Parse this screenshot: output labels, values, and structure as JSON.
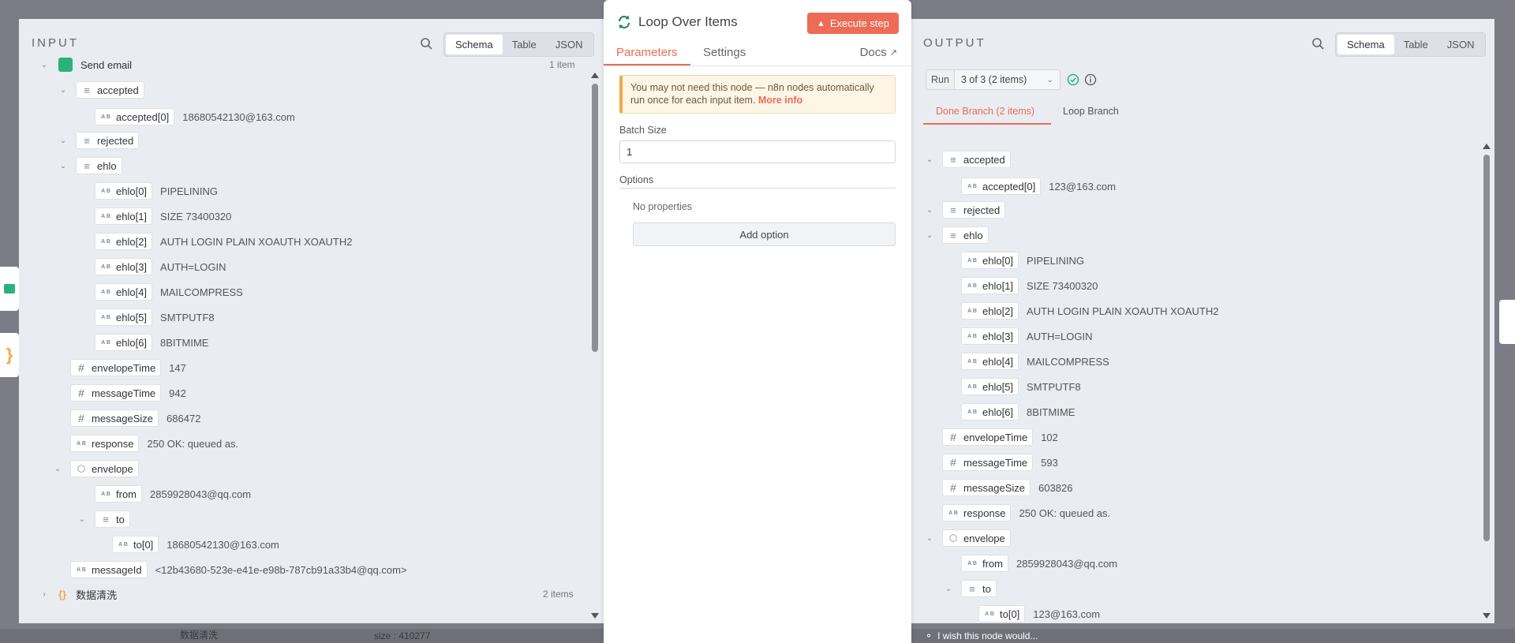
{
  "background": {
    "bottom_left_text": "数据清洗",
    "bottom_mid_text": "size : 410277"
  },
  "input": {
    "title": "INPUT",
    "view_tabs": [
      "Schema",
      "Table",
      "JSON"
    ],
    "root": {
      "label": "Send email",
      "count": "1 item"
    },
    "rows": [
      {
        "key": "accepted",
        "type": "list",
        "chev": "down"
      },
      {
        "key": "accepted[0]",
        "type": "str",
        "value": "18680542130@163.com"
      },
      {
        "key": "rejected",
        "type": "list",
        "chev": "down"
      },
      {
        "key": "ehlo",
        "type": "list",
        "chev": "down"
      },
      {
        "key": "ehlo[0]",
        "type": "str",
        "value": "PIPELINING"
      },
      {
        "key": "ehlo[1]",
        "type": "str",
        "value": "SIZE 73400320"
      },
      {
        "key": "ehlo[2]",
        "type": "str",
        "value": "AUTH LOGIN PLAIN XOAUTH XOAUTH2"
      },
      {
        "key": "ehlo[3]",
        "type": "str",
        "value": "AUTH=LOGIN"
      },
      {
        "key": "ehlo[4]",
        "type": "str",
        "value": "MAILCOMPRESS"
      },
      {
        "key": "ehlo[5]",
        "type": "str",
        "value": "SMTPUTF8"
      },
      {
        "key": "ehlo[6]",
        "type": "str",
        "value": "8BITMIME"
      },
      {
        "key": "envelopeTime",
        "type": "num",
        "value": "147"
      },
      {
        "key": "messageTime",
        "type": "num",
        "value": "942"
      },
      {
        "key": "messageSize",
        "type": "num",
        "value": "686472"
      },
      {
        "key": "response",
        "type": "str",
        "value": "250 OK: queued as."
      },
      {
        "key": "envelope",
        "type": "obj",
        "chev": "down"
      },
      {
        "key": "from",
        "type": "str",
        "value": "2859928043@qq.com"
      },
      {
        "key": "to",
        "type": "list",
        "chev": "down"
      },
      {
        "key": "to[0]",
        "type": "str",
        "value": "18680542130@163.com"
      },
      {
        "key": "messageId",
        "type": "str",
        "value": "<12b43680-523e-e41e-e98b-787cb91a33b4@qq.com>"
      }
    ],
    "second_root": {
      "label": "数据清洗",
      "count": "2 items"
    }
  },
  "node": {
    "title": "Loop Over Items",
    "execute_label": "Execute step",
    "tabs": [
      "Parameters",
      "Settings"
    ],
    "docs_label": "Docs",
    "notice_text": "You may not need this node — n8n nodes automatically run once for each input item.",
    "notice_link": "More info",
    "batch_size_label": "Batch Size",
    "batch_size_value": "1",
    "options_label": "Options",
    "no_properties": "No properties",
    "add_option": "Add option"
  },
  "output": {
    "title": "OUTPUT",
    "view_tabs": [
      "Schema",
      "Table",
      "JSON"
    ],
    "run_label": "Run",
    "run_value": "3 of 3 (2 items)",
    "branch_tabs": [
      "Done Branch (2 items)",
      "Loop Branch"
    ],
    "rows": [
      {
        "key": "accepted",
        "type": "list",
        "chev": "down"
      },
      {
        "key": "accepted[0]",
        "type": "str",
        "value": "123@163.com"
      },
      {
        "key": "rejected",
        "type": "list",
        "chev": "down"
      },
      {
        "key": "ehlo",
        "type": "list",
        "chev": "down"
      },
      {
        "key": "ehlo[0]",
        "type": "str",
        "value": "PIPELINING"
      },
      {
        "key": "ehlo[1]",
        "type": "str",
        "value": "SIZE 73400320"
      },
      {
        "key": "ehlo[2]",
        "type": "str",
        "value": "AUTH LOGIN PLAIN XOAUTH XOAUTH2"
      },
      {
        "key": "ehlo[3]",
        "type": "str",
        "value": "AUTH=LOGIN"
      },
      {
        "key": "ehlo[4]",
        "type": "str",
        "value": "MAILCOMPRESS"
      },
      {
        "key": "ehlo[5]",
        "type": "str",
        "value": "SMTPUTF8"
      },
      {
        "key": "ehlo[6]",
        "type": "str",
        "value": "8BITMIME"
      },
      {
        "key": "envelopeTime",
        "type": "num",
        "value": "102"
      },
      {
        "key": "messageTime",
        "type": "num",
        "value": "593"
      },
      {
        "key": "messageSize",
        "type": "num",
        "value": "603826"
      },
      {
        "key": "response",
        "type": "str",
        "value": "250 OK: queued as."
      },
      {
        "key": "envelope",
        "type": "obj",
        "chev": "down"
      },
      {
        "key": "from",
        "type": "str",
        "value": "2859928043@qq.com"
      },
      {
        "key": "to",
        "type": "list",
        "chev": "down"
      },
      {
        "key": "to[0]",
        "type": "str",
        "value": "123@163.com"
      }
    ],
    "wish_text": "I wish this node would..."
  },
  "colors": {
    "accent": "#ee6b56",
    "success": "#2ab27b"
  }
}
